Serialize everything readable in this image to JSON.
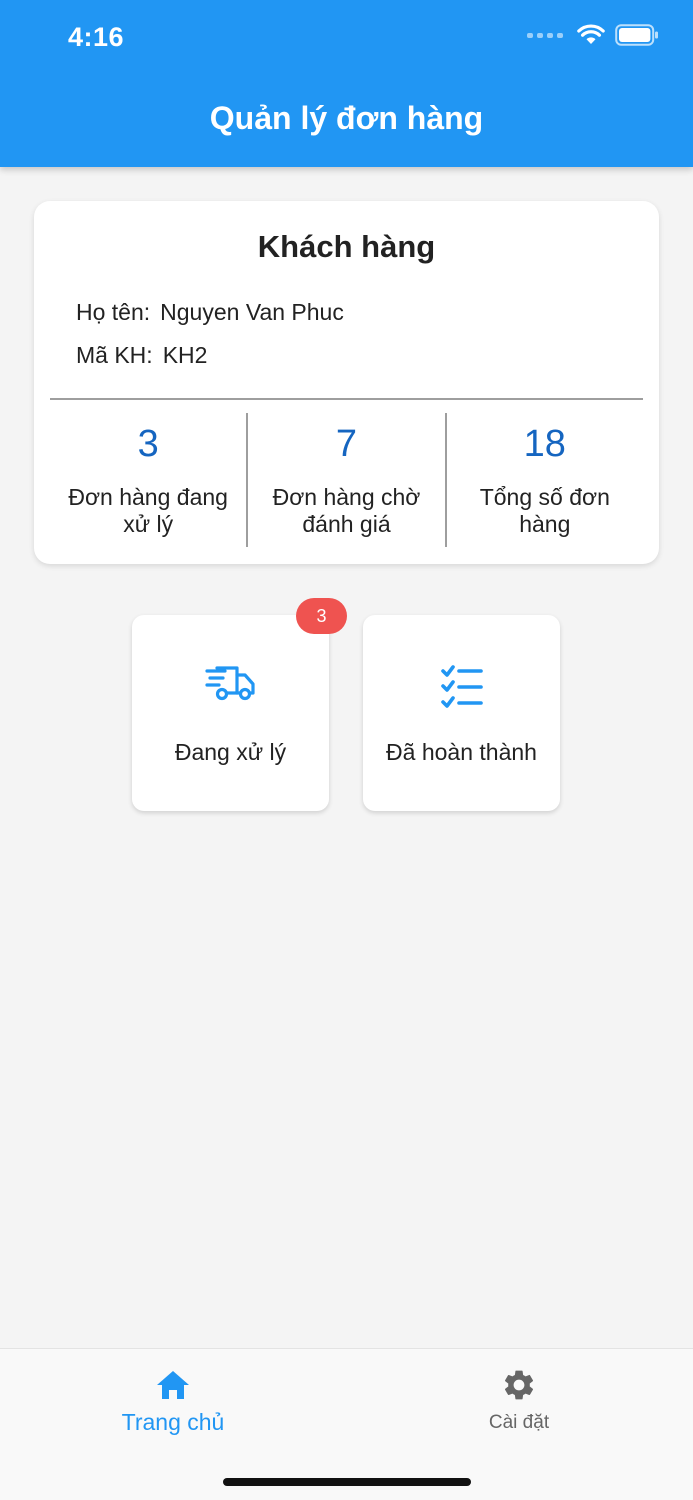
{
  "status_bar": {
    "time": "4:16"
  },
  "header": {
    "title": "Quản lý đơn hàng"
  },
  "customer_card": {
    "title": "Khách hàng",
    "name_label": "Họ tên:",
    "name_value": "Nguyen Van Phuc",
    "id_label": "Mã KH:",
    "id_value": "KH2",
    "stats": [
      {
        "value": "3",
        "label": "Đơn hàng đang xử lý"
      },
      {
        "value": "7",
        "label": "Đơn hàng chờ đánh giá"
      },
      {
        "value": "18",
        "label": "Tổng số đơn hàng"
      }
    ]
  },
  "tiles": {
    "processing": {
      "label": "Đang xử lý",
      "badge": "3",
      "icon": "delivery-truck-icon"
    },
    "completed": {
      "label": "Đã hoàn thành",
      "icon": "checklist-icon"
    }
  },
  "bottom_nav": {
    "home": {
      "label": "Trang chủ",
      "icon": "home-icon",
      "active": true
    },
    "settings": {
      "label": "Cài đặt",
      "icon": "gear-icon",
      "active": false
    }
  },
  "colors": {
    "primary": "#2196f3",
    "stat_value": "#1565c0",
    "badge": "#ef5350",
    "background": "#f4f4f4"
  }
}
